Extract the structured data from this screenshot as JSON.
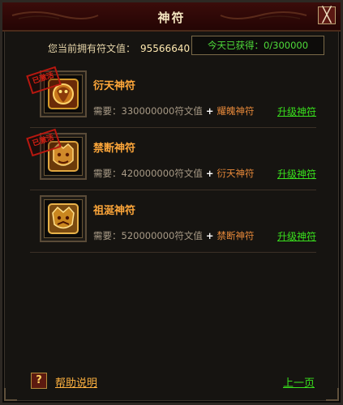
{
  "window": {
    "title": "神符",
    "close_glyph": "╳"
  },
  "header": {
    "owned_label": "您当前拥有符文值：",
    "owned_value": "95566640",
    "today_label": "今天已获得：",
    "today_value": "0/300000"
  },
  "items": [
    {
      "name": "衍天神符",
      "req_label": "需要：",
      "req_amount": "330000000符文值",
      "plus": "+",
      "req_item": "耀魄神符",
      "action": "升级神符",
      "stamp": "已激活",
      "icon": "dragon-emblem-icon"
    },
    {
      "name": "禁断神符",
      "req_label": "需要：",
      "req_amount": "420000000符文值",
      "plus": "+",
      "req_item": "衍天神符",
      "action": "升级神符",
      "stamp": "已激活",
      "icon": "beast-emblem-icon"
    },
    {
      "name": "祖涎神符",
      "req_label": "需要：",
      "req_amount": "520000000符文值",
      "plus": "+",
      "req_item": "禁断神符",
      "action": "升级神符",
      "stamp": null,
      "icon": "beast-emblem-icon"
    }
  ],
  "footer": {
    "help_icon": "?",
    "help_label": "帮助说明",
    "prev_label": "上一页"
  },
  "colors": {
    "accent_gold": "#ffa73a",
    "link_green": "#39e01d",
    "stamp_red": "#d61e12"
  }
}
